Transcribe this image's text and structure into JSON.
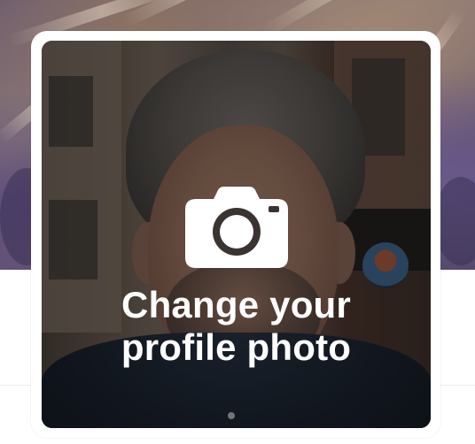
{
  "header": {
    "banner_alt": "",
    "banner_colors": {
      "blossom": "#5b4a7e",
      "rock": "#a08672"
    }
  },
  "avatar": {
    "frame_color": "#ffffff",
    "overlay_color": "rgba(0,0,0,0.45)",
    "icon": "camera-icon"
  },
  "change_photo": {
    "line1": "Change your",
    "line2": "profile photo"
  }
}
